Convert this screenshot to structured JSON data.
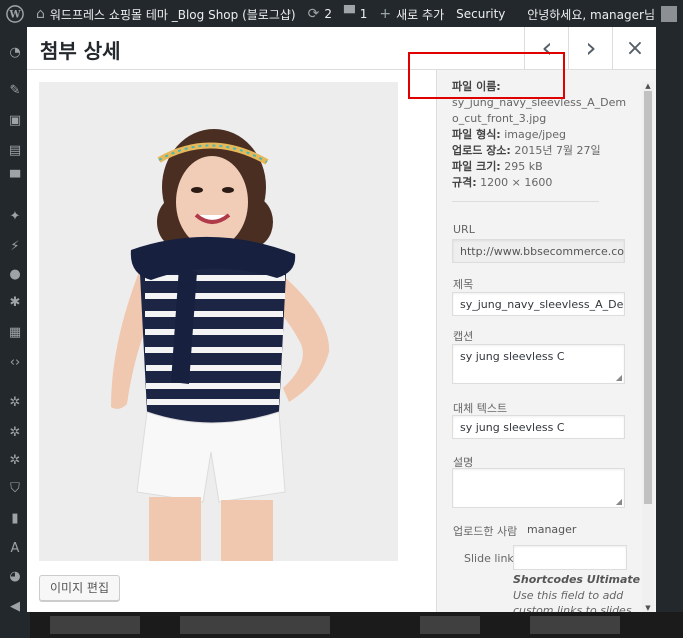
{
  "admin_bar": {
    "site_name": "워드프레스 쇼핑몰 테마 _Blog Shop (블로그샵)",
    "updates_count": "2",
    "comments_count": "1",
    "new_label": "새로 추가",
    "security_label": "Security",
    "greeting": "안녕하세요, manager님"
  },
  "modal": {
    "title": "첨부 상세",
    "prev_icon": "‹",
    "next_icon": "›",
    "close_icon": "×"
  },
  "file_info": {
    "filename_label": "파일 이름:",
    "filename_line1": "sy_jung_navy_sleevless_A_Dem",
    "filename_line2": "o_cut_front_3.jpg",
    "filetype_label": "파일 형식:",
    "filetype": "image/jpeg",
    "uploaded_label": "업로드 장소:",
    "uploaded": "2015년 7월 27일",
    "filesize_label": "파일 크기:",
    "filesize": "295 kB",
    "dimensions_label": "규격:",
    "dimensions": "1200 × 1600"
  },
  "fields": {
    "url_label": "URL",
    "url_value": "http://www.bbsecommerce.com/w",
    "title_label": "제목",
    "title_value": "sy_jung_navy_sleevless_A_Demo_c",
    "caption_label": "캡션",
    "caption_value": "sy jung sleevless C",
    "alt_label": "대체 텍스트",
    "alt_value": "sy jung sleevless C",
    "description_label": "설명",
    "description_value": "",
    "uploaded_by_label": "업로드한 사람",
    "uploaded_by_value": "manager",
    "slide_link_label": "Slide link",
    "slide_link_value": ""
  },
  "shortcodes_note": {
    "title": "Shortcodes Ultimate",
    "text": "Use this field to add custom links to slides"
  },
  "edit_image_label": "이미지 편집",
  "colors": {
    "admin_bg": "#23282d",
    "highlight": "#e00000",
    "shirt_navy": "#1d2545"
  }
}
